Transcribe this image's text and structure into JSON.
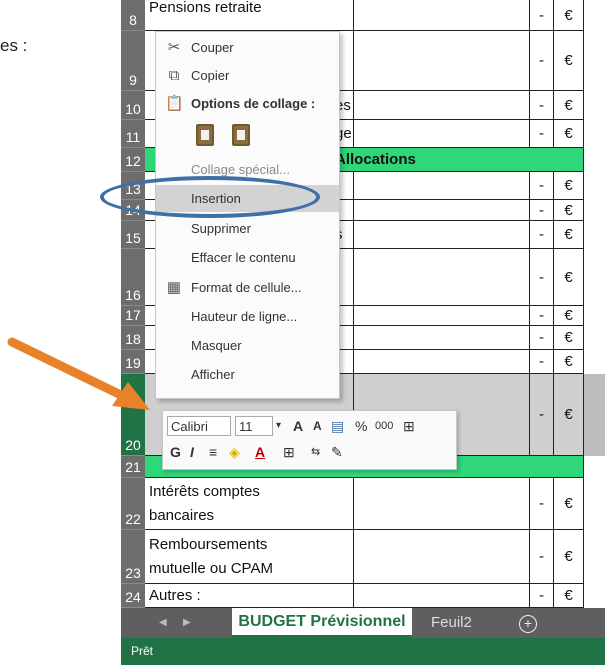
{
  "outer_text": "es :",
  "context_menu": {
    "items": [
      {
        "label": "Couper",
        "icon": "scissors-icon",
        "state": "normal"
      },
      {
        "label": "Copier",
        "icon": "copy-icon",
        "state": "normal"
      },
      {
        "label": "Options de collage :",
        "icon": "paste-icon",
        "state": "header"
      },
      {
        "label": "Collage spécial...",
        "state": "disabled"
      },
      {
        "label": "Insertion",
        "state": "highlighted"
      },
      {
        "label": "Supprimer",
        "state": "normal"
      },
      {
        "label": "Effacer le contenu",
        "state": "normal"
      },
      {
        "label": "Format de cellule...",
        "icon": "format-cells-icon",
        "state": "normal"
      },
      {
        "label": "Hauteur de ligne...",
        "state": "normal"
      },
      {
        "label": "Masquer",
        "state": "normal"
      },
      {
        "label": "Afficher",
        "state": "normal"
      }
    ]
  },
  "mini_toolbar": {
    "font": "Calibri",
    "size": "11",
    "row1": [
      "A",
      "A",
      "%",
      "000"
    ],
    "row2": [
      "G",
      "I",
      "A"
    ]
  },
  "rows": [
    {
      "num": "8",
      "label": "Pensions retraite",
      "dash": "-",
      "euro": "€"
    },
    {
      "num": "9",
      "label": "",
      "dash": "-",
      "euro": "€"
    },
    {
      "num": "10",
      "label": "es",
      "dash": "-",
      "euro": "€"
    },
    {
      "num": "11",
      "label": "ge",
      "dash": "-",
      "euro": "€"
    },
    {
      "num": "12",
      "label": "Allocations",
      "dash": "",
      "euro": ""
    },
    {
      "num": "13",
      "label": "",
      "dash": "-",
      "euro": "€"
    },
    {
      "num": "14",
      "label": "",
      "dash": "-",
      "euro": "€"
    },
    {
      "num": "15",
      "label": "s",
      "dash": "-",
      "euro": "€"
    },
    {
      "num": "16",
      "label": "",
      "dash": "-",
      "euro": "€"
    },
    {
      "num": "17",
      "label": "",
      "dash": "-",
      "euro": "€"
    },
    {
      "num": "18",
      "label": "",
      "dash": "-",
      "euro": "€"
    },
    {
      "num": "19",
      "label": "",
      "dash": "-",
      "euro": "€"
    },
    {
      "num": "20",
      "label": "",
      "dash": "-",
      "euro": "€"
    },
    {
      "num": "21",
      "label": "",
      "dash": "",
      "euro": ""
    },
    {
      "num": "22",
      "label_line1": "Intérêts comptes",
      "label_line2": "bancaires",
      "dash": "-",
      "euro": "€"
    },
    {
      "num": "23",
      "label_line1": "Remboursements",
      "label_line2": "mutuelle ou CPAM",
      "dash": "-",
      "euro": "€"
    },
    {
      "num": "24",
      "label": "Autres :",
      "dash": "-",
      "euro": "€"
    }
  ],
  "sheet_tabs": {
    "active": "BUDGET Prévisionnel",
    "other": "Feuil2"
  },
  "status_bar": "Prêt",
  "colors": {
    "header_green": "#2fd67a",
    "excel_green": "#217346",
    "arrow_orange": "#e8822a",
    "ellipse_blue": "#3f6fa6"
  }
}
